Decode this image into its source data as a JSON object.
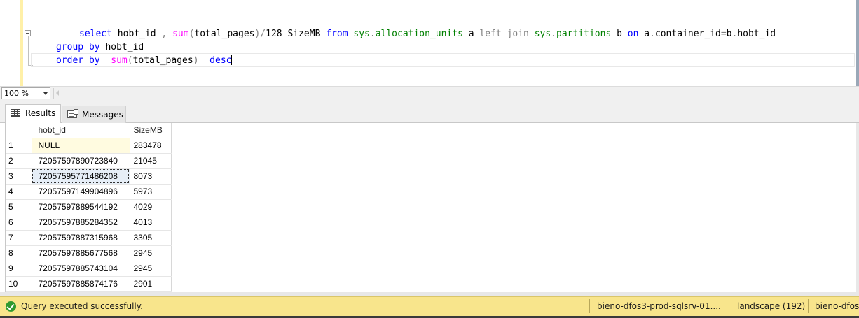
{
  "editor": {
    "line1": {
      "kw1": "select",
      "t1": " hobt_id ",
      "op1": ",",
      "t2": " ",
      "fn1": "sum",
      "op2": "(",
      "t3": "total_pages",
      "op3": ")/",
      "t4": "128 SizeMB ",
      "kw2": "from",
      "t5": " ",
      "sys1": "sys",
      "op4": ".",
      "sys2": "allocation_units",
      "t6": " a ",
      "kw3": "left join",
      "t7": " ",
      "sys3": "sys",
      "op5": ".",
      "sys4": "partitions",
      "t8": " b ",
      "kw4": "on",
      "t9": " a",
      "op6": ".",
      "t10": "container_id",
      "op7": "=",
      "t11": "b",
      "op8": ".",
      "t12": "hobt_id"
    },
    "line2": {
      "kw1": "group by",
      "t1": " hobt_id"
    },
    "line3": {
      "kw1": "order by",
      "t1": "  ",
      "fn1": "sum",
      "op1": "(",
      "t2": "total_pages",
      "op2": ")",
      "t3": "  ",
      "kw2": "desc"
    }
  },
  "zoom": {
    "value": "100 %"
  },
  "tabs": {
    "results": "Results",
    "messages": "Messages"
  },
  "grid": {
    "columns": {
      "hobt_id": "hobt_id",
      "size": "SizeMB"
    },
    "rows": [
      {
        "n": "1",
        "hobt_id": "NULL",
        "size": "283478"
      },
      {
        "n": "2",
        "hobt_id": "72057597890723840",
        "size": "21045"
      },
      {
        "n": "3",
        "hobt_id": "72057595771486208",
        "size": "8073"
      },
      {
        "n": "4",
        "hobt_id": "72057597149904896",
        "size": "5973"
      },
      {
        "n": "5",
        "hobt_id": "72057597889544192",
        "size": "4029"
      },
      {
        "n": "6",
        "hobt_id": "72057597885284352",
        "size": "4013"
      },
      {
        "n": "7",
        "hobt_id": "72057597887315968",
        "size": "3305"
      },
      {
        "n": "8",
        "hobt_id": "72057597885677568",
        "size": "2945"
      },
      {
        "n": "9",
        "hobt_id": "72057597885743104",
        "size": "2945"
      },
      {
        "n": "10",
        "hobt_id": "72057597885874176",
        "size": "2901"
      }
    ]
  },
  "status": {
    "message": "Query executed successfully.",
    "server": "bieno-dfos3-prod-sqlsrv-01....",
    "database": "landscape (192)",
    "user": "bieno-dfos"
  },
  "colors": {
    "status_bg": "#f8e58c",
    "keyword": "#0000ff",
    "function": "#ff00ff",
    "system_object": "#008000",
    "ok": "#2f9a2f"
  }
}
